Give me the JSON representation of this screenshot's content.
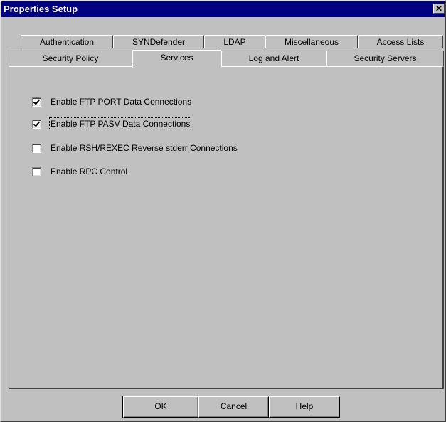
{
  "window": {
    "title": "Properties Setup",
    "close_symbol": "✕"
  },
  "tabs": {
    "row1": [
      {
        "label": "Authentication"
      },
      {
        "label": "SYNDefender"
      },
      {
        "label": "LDAP"
      },
      {
        "label": "Miscellaneous"
      },
      {
        "label": "Access Lists"
      }
    ],
    "row2": [
      {
        "label": "Security Policy"
      },
      {
        "label": "Services",
        "active": true
      },
      {
        "label": "Log and Alert"
      },
      {
        "label": "Security Servers"
      }
    ]
  },
  "options": [
    {
      "label": "Enable FTP PORT Data Connections",
      "checked": true
    },
    {
      "label": "Enable FTP PASV Data Connections",
      "checked": true
    },
    {
      "label": "Enable RSH/REXEC Reverse stderr Connections",
      "checked": false
    },
    {
      "label": "Enable RPC Control",
      "checked": false
    }
  ],
  "buttons": {
    "ok": "OK",
    "cancel": "Cancel",
    "help": "Help"
  }
}
